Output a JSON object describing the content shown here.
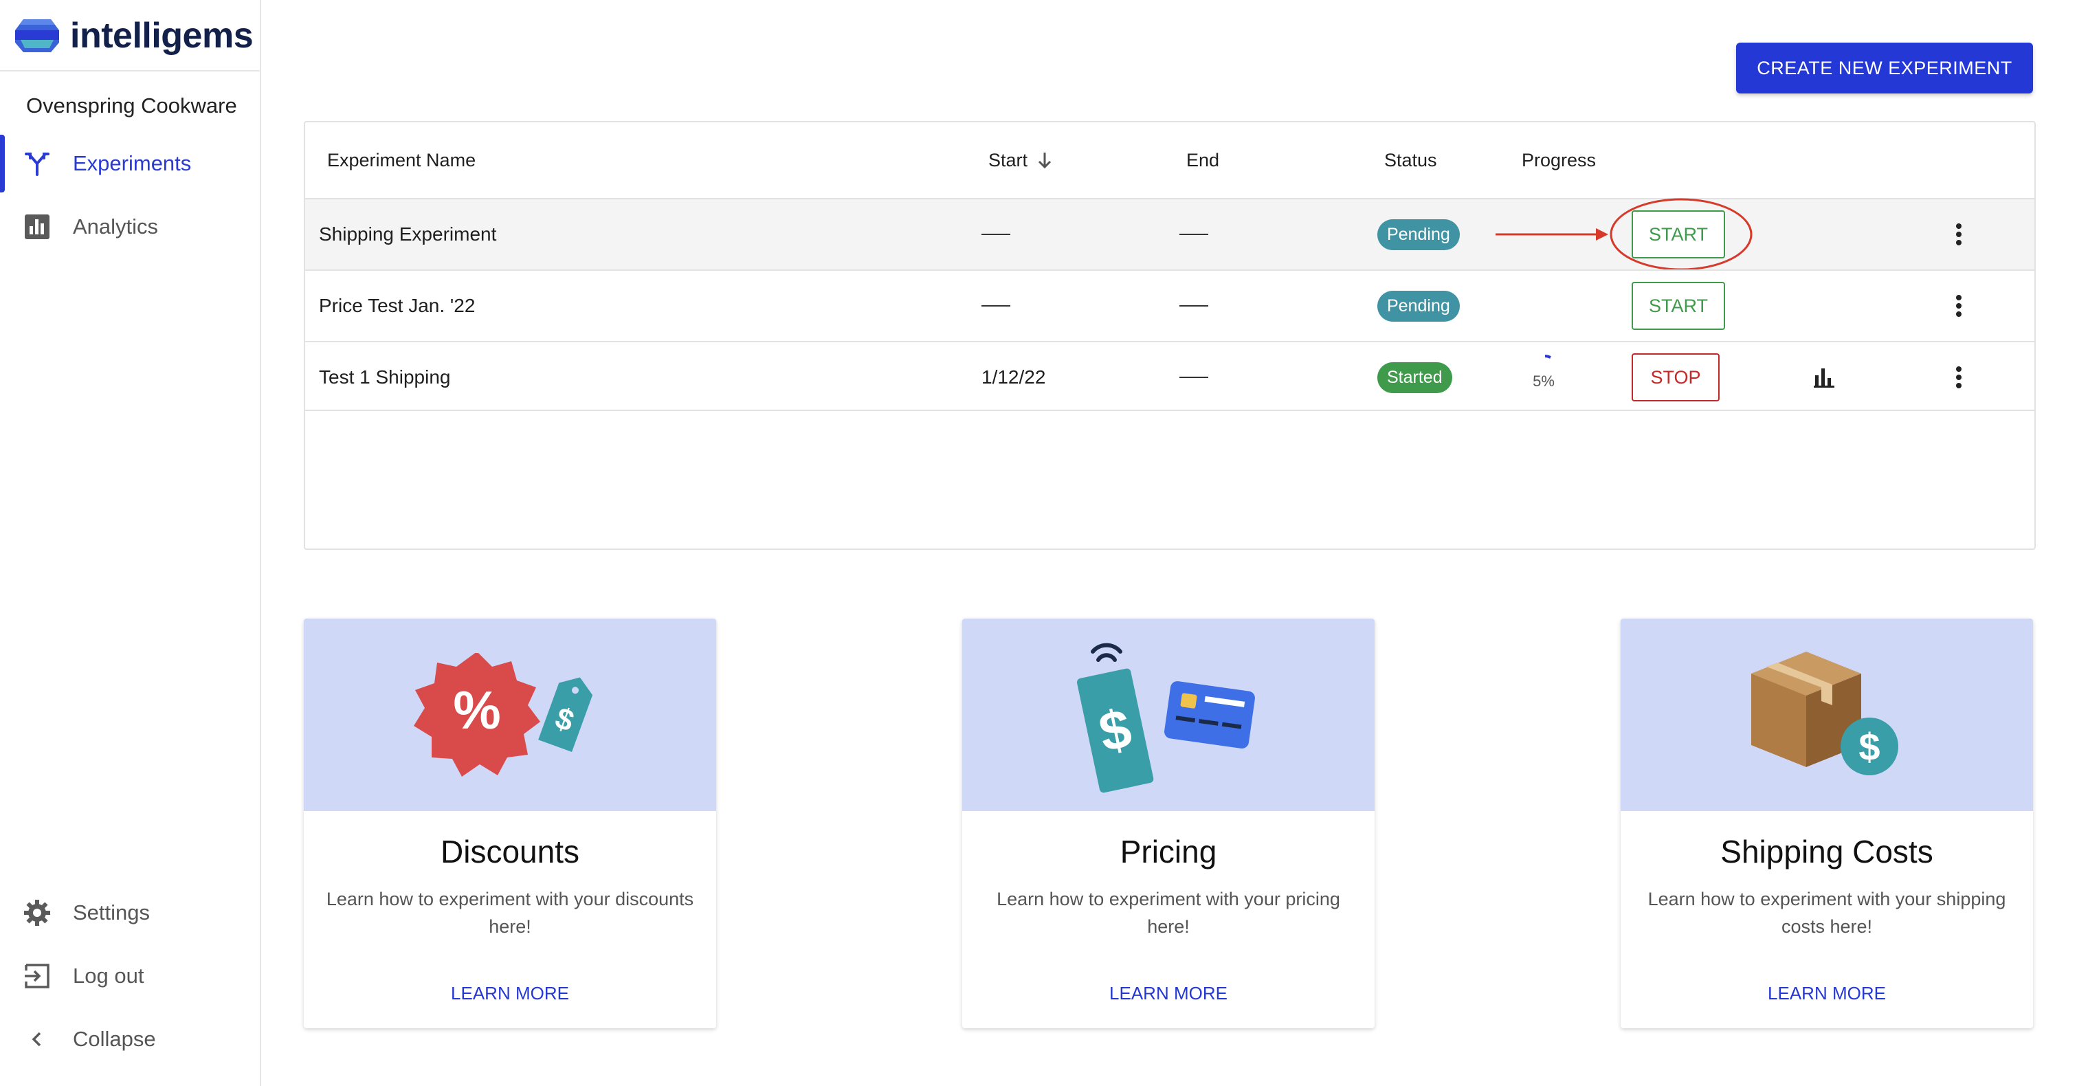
{
  "brand": {
    "name": "intelligems"
  },
  "store": {
    "name": "Ovenspring Cookware"
  },
  "nav": {
    "experiments": "Experiments",
    "analytics": "Analytics",
    "settings": "Settings",
    "logout": "Log out",
    "collapse": "Collapse"
  },
  "actions": {
    "create": "CREATE NEW EXPERIMENT"
  },
  "table": {
    "headers": {
      "name": "Experiment Name",
      "start": "Start",
      "end": "End",
      "status": "Status",
      "progress": "Progress"
    },
    "rows": [
      {
        "name": "Shipping Experiment",
        "start": "",
        "end": "",
        "status": "Pending",
        "progress": "",
        "action": "START"
      },
      {
        "name": "Price Test Jan. '22",
        "start": "",
        "end": "",
        "status": "Pending",
        "progress": "",
        "action": "START"
      },
      {
        "name": "Test 1 Shipping",
        "start": "1/12/22",
        "end": "",
        "status": "Started",
        "progress": "5%",
        "action": "STOP"
      }
    ]
  },
  "cards": [
    {
      "title": "Discounts",
      "desc": "Learn how to experiment with your discounts here!",
      "link": "LEARN MORE"
    },
    {
      "title": "Pricing",
      "desc": "Learn how to experiment with your pricing here!",
      "link": "LEARN MORE"
    },
    {
      "title": "Shipping Costs",
      "desc": "Learn how to experiment with your shipping costs here!",
      "link": "LEARN MORE"
    }
  ],
  "colors": {
    "accent": "#2438d6",
    "pending": "#3f93a2",
    "started": "#3f9a4b",
    "stop": "#c62828",
    "card_bg": "#cfd8f6",
    "annotation": "#d63a2a"
  }
}
